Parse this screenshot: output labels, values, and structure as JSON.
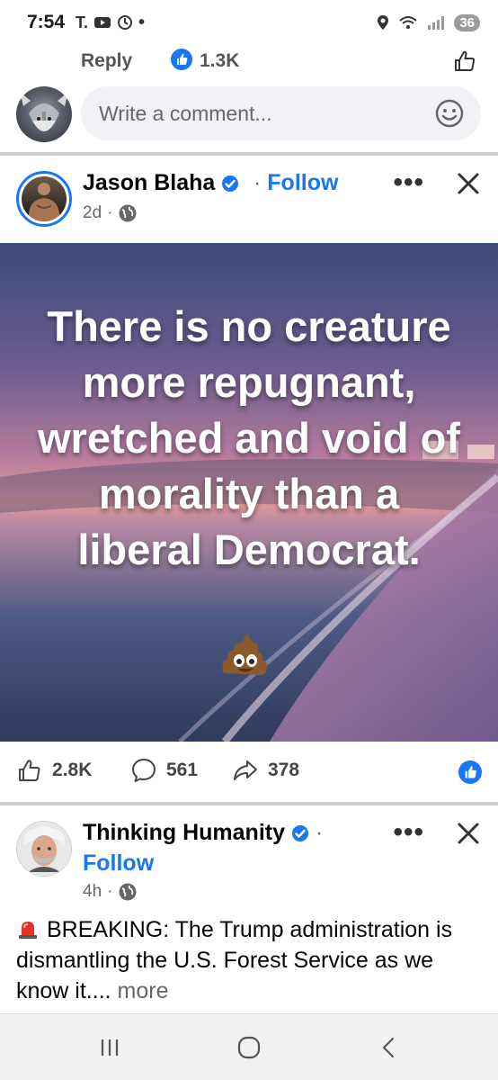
{
  "status_bar": {
    "time": "7:54",
    "left_icons": "T.",
    "battery": "36"
  },
  "prev_post": {
    "reply_label": "Reply",
    "like_count": "1.3K"
  },
  "composer": {
    "placeholder": "Write a comment..."
  },
  "post1": {
    "author": "Jason Blaha",
    "follow": "Follow",
    "time": "2d",
    "image_text": "There is no creature more repugnant, wretched and void of morality than a liberal Democrat.",
    "likes": "2.8K",
    "comments": "561",
    "shares": "378"
  },
  "post2": {
    "author": "Thinking Humanity",
    "follow": "Follow",
    "time": "4h",
    "text": "BREAKING: The Trump administration is dismantling the U.S. Forest Service as we know it....",
    "more": "more"
  },
  "icons": {
    "verified": "verified-badge-icon",
    "globe": "globe-icon",
    "like": "thumbs-up-icon",
    "comment": "comment-bubble-icon",
    "share": "share-arrow-icon",
    "siren": "siren-emoji-icon",
    "poop": "poop-emoji-icon"
  },
  "colors": {
    "facebook_blue": "#1877f2",
    "secondary_text": "#65676b",
    "divider": "#c9ccd1"
  }
}
